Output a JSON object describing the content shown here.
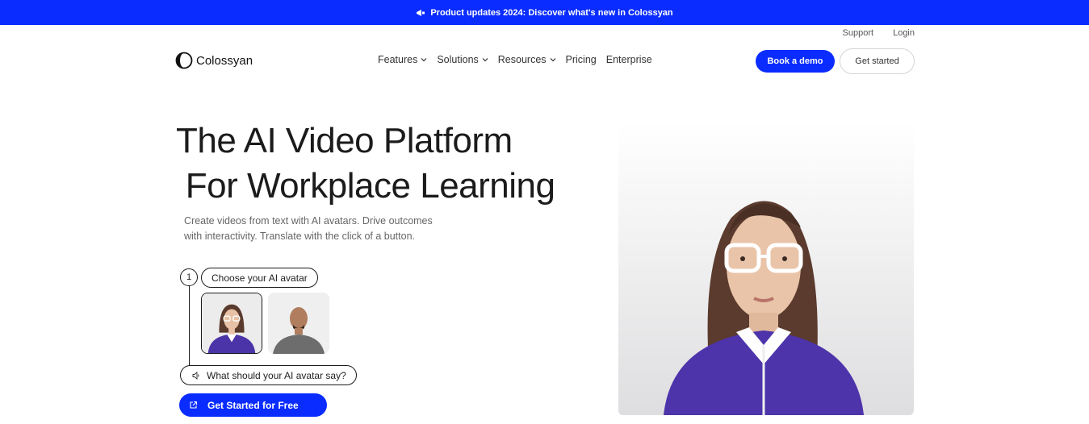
{
  "banner": {
    "text": "Product updates 2024: Discover what's new in Colossyan",
    "icon": "megaphone-icon"
  },
  "utility": {
    "support": "Support",
    "login": "Login"
  },
  "logo": {
    "text": "Colossyan"
  },
  "nav": {
    "features": "Features",
    "solutions": "Solutions",
    "resources": "Resources",
    "pricing": "Pricing",
    "enterprise": "Enterprise"
  },
  "header_buttons": {
    "demo": "Book a demo",
    "start": "Get started"
  },
  "hero": {
    "line1": "The AI Video Platform",
    "line2": " For Workplace Learning",
    "subtext": "Create videos from text with AI avatars. Drive outcomes with interactivity. Translate with the click of a button."
  },
  "builder": {
    "step_number": "1",
    "choose_label": "Choose your AI avatar",
    "say_label": "What should your AI avatar say?",
    "cta_label": "Get Started for Free"
  },
  "colors": {
    "accent": "#0a2cff",
    "text": "#1b1b1b"
  }
}
